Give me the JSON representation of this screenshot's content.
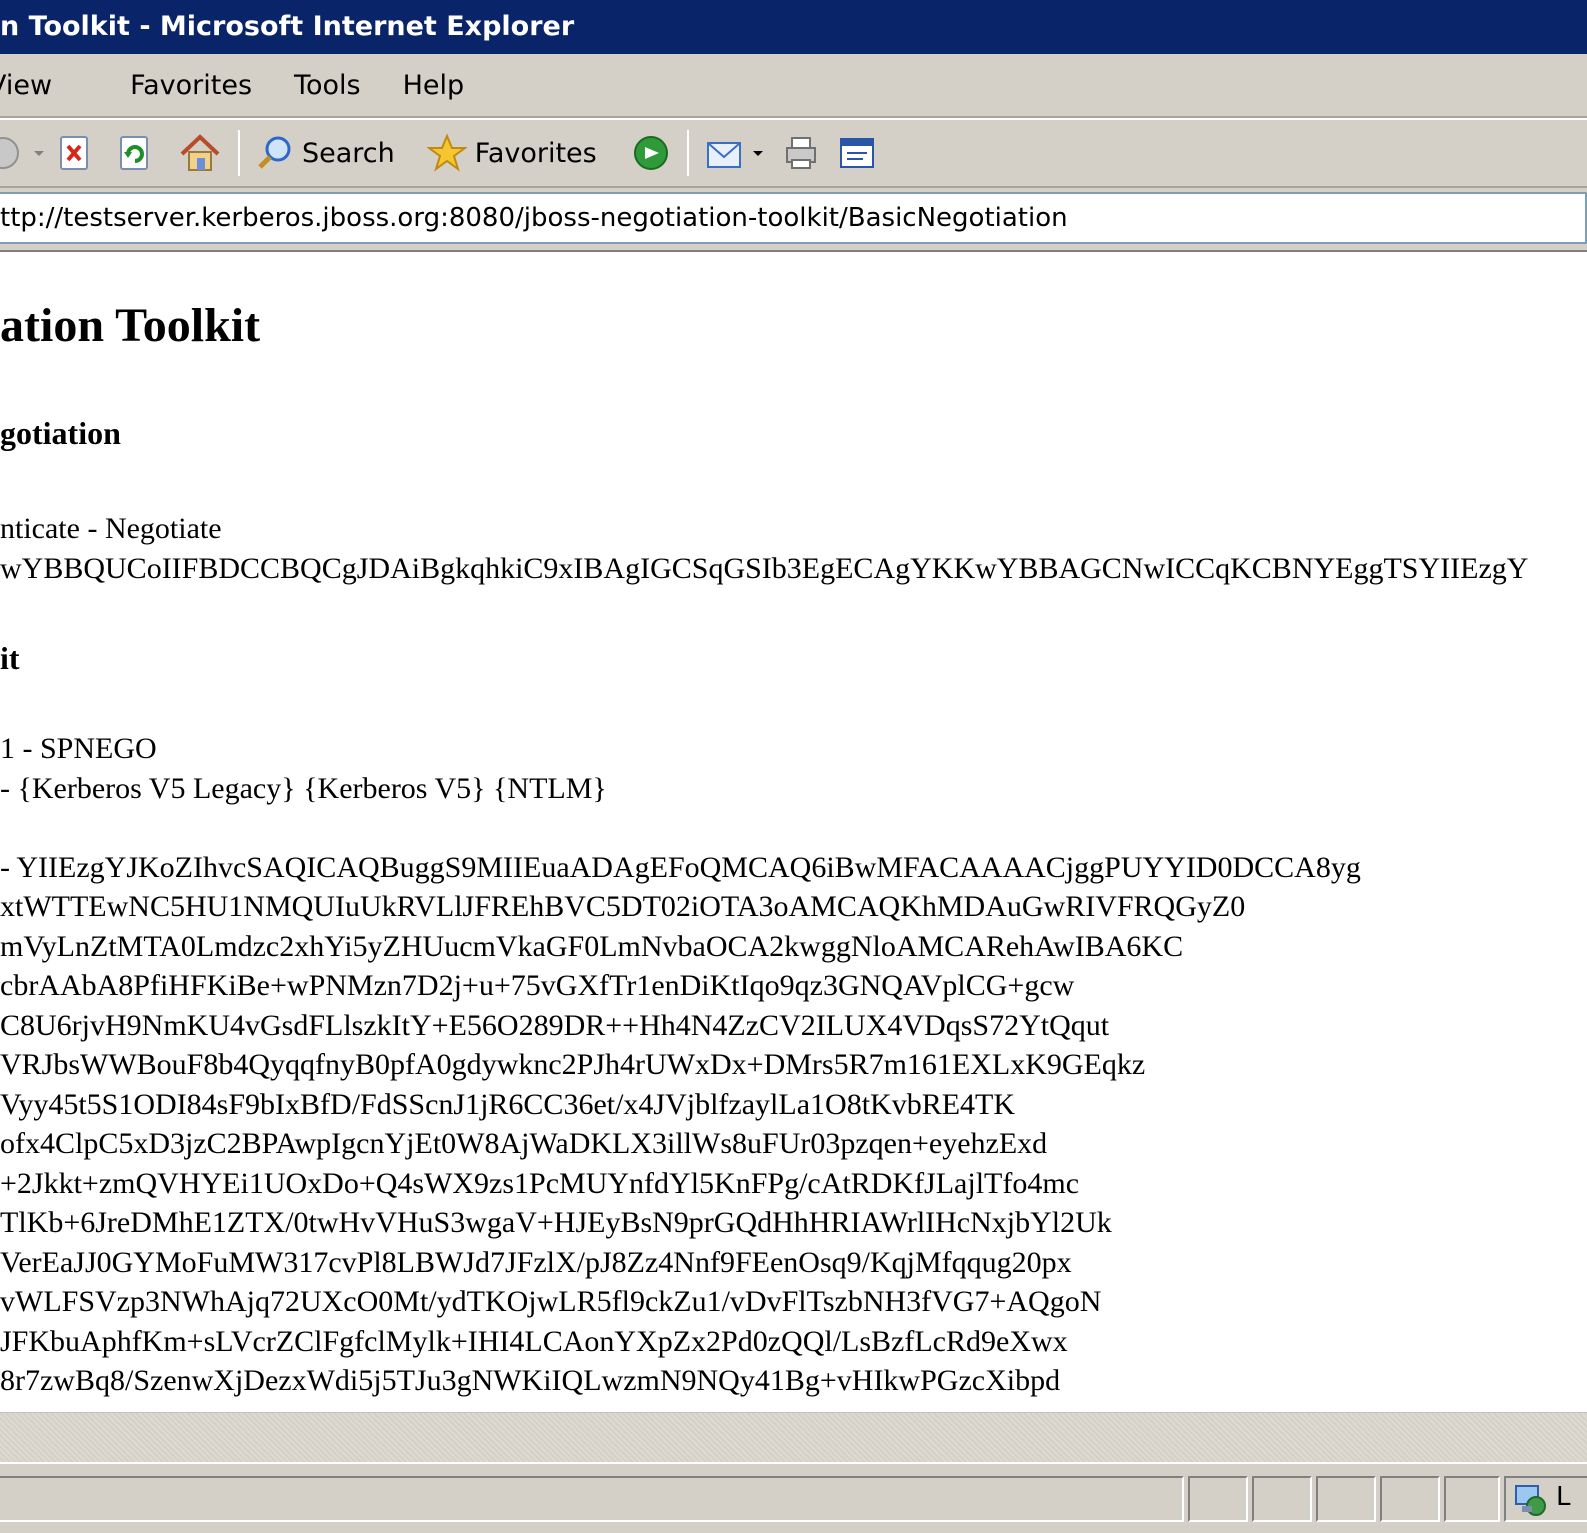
{
  "window": {
    "title": "n Toolkit - Microsoft Internet Explorer"
  },
  "menu": {
    "items": [
      "View",
      "Favorites",
      "Tools",
      "Help"
    ]
  },
  "toolbar": {
    "search_label": "Search",
    "favorites_label": "Favorites"
  },
  "address": {
    "url": "ttp://testserver.kerberos.jboss.org:8080/jboss-negotiation-toolkit/BasicNegotiation"
  },
  "page": {
    "heading": "ation Toolkit",
    "section1_heading": "gotiation",
    "section1_line1": "nticate - Negotiate",
    "section1_line2": "wYBBQUCoIIFBDCCBQCgJDAiBgkqhkiC9xIBAgIGCSqGSIb3EgECAgYKKwYBBAGCNwICCqKCBNYEggTSYIIEzgY",
    "section2_heading": "it",
    "section2_line1": "1 - SPNEGO",
    "section2_line2": "- {Kerberos V5 Legacy} {Kerberos V5} {NTLM}",
    "token_lines": [
      "- YIIEzgYJKoZIhvcSAQICAQBuggS9MIIEuaADAgEFoQMCAQ6iBwMFACAAAACjggPUYYID0DCCA8yg",
      "xtWTTEwNC5HU1NMQUIuUkRVLlJFREhBVC5DT02iOTA3oAMCAQKhMDAuGwRIVFRQGyZ0",
      "mVyLnZtMTA0Lmdzc2xhYi5yZHUucmVkaGF0LmNvbaOCA2kwggNloAMCARehAwIBA6KC",
      "cbrAAbA8PfiHFKiBe+wPNMzn7D2j+u+75vGXfTr1enDiKtIqo9qz3GNQAVplCG+gcw",
      "C8U6rjvH9NmKU4vGsdFLlszkItY+E56O289DR++Hh4N4ZzCV2ILUX4VDqsS72YtQqut",
      "VRJbsWWBouF8b4QyqqfnyB0pfA0gdywknc2PJh4rUWxDx+DMrs5R7m161EXLxK9GEqkz",
      "Vyy45t5S1ODI84sF9bIxBfD/FdSScnJ1jR6CC36et/x4JVjblfzaylLa1O8tKvbRE4TK",
      "ofx4ClpC5xD3jzC2BPAwpIgcnYjEt0W8AjWaDKLX3illWs8uFUr03pzqen+eyehzExd",
      "+2Jkkt+zmQVHYEi1UOxDo+Q4sWX9zs1PcMUYnfdYl5KnFPg/cAtRDKfJLajlTfo4mc",
      "TlKb+6JreDMhE1ZTX/0twHvVHuS3wgaV+HJEyBsN9prGQdHhHRIAWrlIHcNxjbYl2Uk",
      "VerEaJJ0GYMoFuMW317cvPl8LBWJd7JFzlX/pJ8Zz4Nnf9FEenOsq9/KqjMfqqug20px",
      "vWLFSVzp3NWhAjq72UXcO0Mt/ydTKOjwLR5fl9ckZu1/vDvFlTszbNH3fVG7+AQgoN",
      "JFKbuAphfKm+sLVcrZClFgfclMylk+IHI4LCAonYXpZx2Pd0zQQl/LsBzfLcRd9eXwx",
      "8r7zwBq8/SzenwXjDezxWdi5j5TJu3gNWKiIQLwzmN9NQy41Bg+vHIkwPGzcXibpd"
    ]
  },
  "status": {
    "zone_text": "L"
  }
}
